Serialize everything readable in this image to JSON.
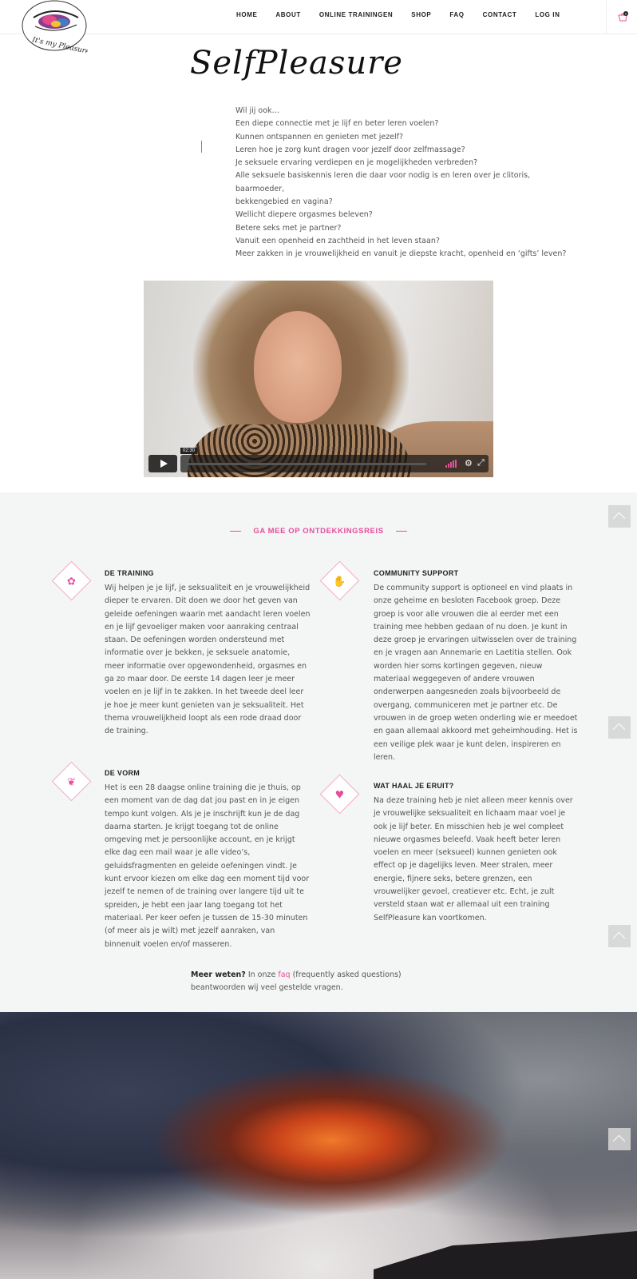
{
  "header": {
    "logo_text": "It's my Pleasure",
    "nav": [
      "HOME",
      "ABOUT",
      "ONLINE TRAININGEN",
      "SHOP",
      "FAQ",
      "CONTACT",
      "LOG IN"
    ],
    "cart_count": "0"
  },
  "title": "SelfPleasure",
  "intro_lines": [
    "Wil jij ook…",
    "Een diepe connectie met je lijf en beter leren voelen?",
    "Kunnen ontspannen en genieten met jezelf?",
    "Leren hoe je zorg kunt dragen voor jezelf door zelfmassage?",
    "Je seksuele ervaring verdiepen en je mogelijkheden verbreden?",
    "Alle seksuele basiskennis leren die daar voor nodig is en leren over je clitoris, baarmoeder,",
    "bekkengebied en vagina?",
    "Wellicht diepere orgasmes beleven?",
    "Betere seks met je partner?",
    "Vanuit een openheid en zachtheid in het leven staan?",
    "Meer zakken in je vrouwelijkheid en vanuit je diepste kracht, openheid en ‘gifts’ leven?"
  ],
  "video": {
    "time": "02:30"
  },
  "features": {
    "heading": "GA MEE OP ONTDEKKINGSREIS",
    "items": [
      {
        "title": "DE TRAINING",
        "icon": "flower-icon",
        "text": "Wij helpen je je lijf, je seksualiteit en je vrouwelijkheid dieper te ervaren. Dit doen we door het geven van geleide oefeningen waarin met aandacht leren voelen en je lijf gevoeliger maken voor aanraking centraal staan. De oefeningen worden ondersteund met informatie over je bekken, je seksuele anatomie, meer informatie over opgewondenheid, orgasmes en ga zo maar door. De eerste 14 dagen leer je meer voelen en je lijf in te zakken. In het tweede deel leer je hoe je meer kunt genieten van je seksualiteit. Het thema vrouwelijkheid loopt als een rode draad door de training."
      },
      {
        "title": "COMMUNITY SUPPORT",
        "icon": "hands-icon",
        "text": "De community support is optioneel en vind plaats in onze geheime en besloten Facebook groep. Deze groep is voor alle vrouwen die al eerder met een training mee hebben gedaan of nu doen. Je kunt in deze groep je ervaringen uitwisselen over de training en je vragen aan Annemarie en Laetitia stellen. Ook worden hier soms kortingen gegeven, nieuw materiaal weggegeven of andere vrouwen onderwerpen aangesneden zoals bijvoorbeeld de overgang, communiceren met je partner etc. De vrouwen in de groep weten onderling wie er meedoet en gaan allemaal akkoord met geheimhouding. Het is een veilige plek waar je kunt delen, inspireren en leren."
      },
      {
        "title": "DE VORM",
        "icon": "leaf-icon",
        "text": "Het is een 28 daagse online training die je thuis, op een moment van de dag dat jou past en in je eigen tempo kunt volgen. Als je je inschrijft kun je de dag daarna starten. Je krijgt toegang tot de online omgeving met je persoonlijke account, en je krijgt elke dag een mail waar je alle video’s, geluidsfragmenten en geleide oefeningen vindt. Je kunt ervoor kiezen om elke dag een moment tijd voor jezelf te nemen of de training over langere tijd uit te spreiden, je hebt een jaar lang toegang tot het materiaal. Per keer oefen je tussen de 15-30 minuten (of meer als je wilt) met jezelf aanraken, van binnenuit voelen en/of masseren."
      },
      {
        "title": "WAT HAAL JE ERUIT?",
        "icon": "heart-icon",
        "text": "Na deze training heb je niet alleen meer kennis over je vrouwelijke seksualiteit en lichaam maar voel je ook je lijf beter. En misschien heb je wel compleet nieuwe orgasmes beleefd. Vaak heeft beter leren voelen en meer (seksueel) kunnen genieten ook effect op je dagelijks leven. Meer stralen, meer energie, fijnere seks, betere grenzen, een vrouwelijker gevoel, creatiever etc. Echt, je zult versteld staan wat er allemaal uit een training SelfPleasure kan voortkomen."
      }
    ],
    "meer_bold": "Meer weten?",
    "meer_pre": " In onze ",
    "meer_link": "faq",
    "meer_post": " (frequently asked questions) beantwoorden wij veel gestelde vragen."
  },
  "colors": {
    "accent": "#e84d9b",
    "section_bg": "#f4f5f5"
  }
}
